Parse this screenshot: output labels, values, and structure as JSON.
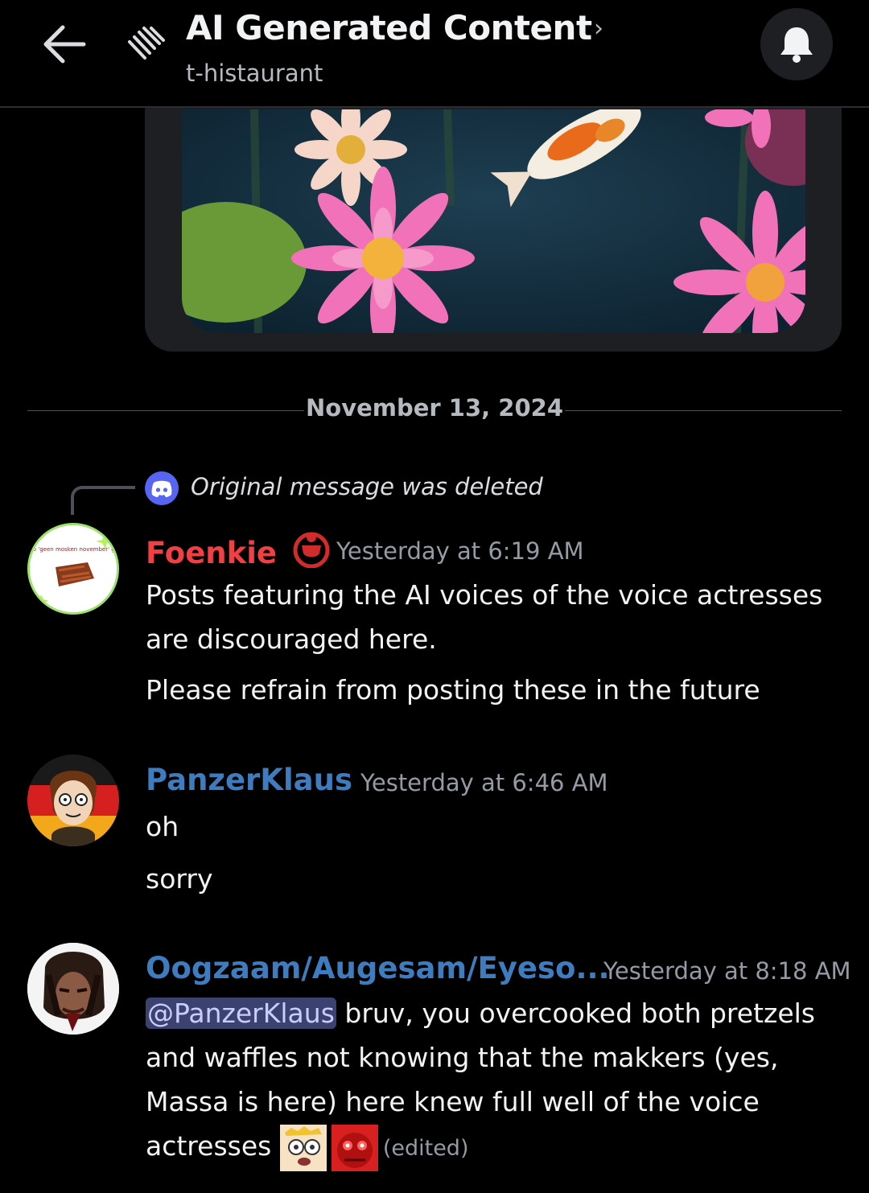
{
  "header": {
    "title": "AI Generated Content",
    "subtitle": "t-histaurant",
    "chevron": "›"
  },
  "date_divider": "November 13, 2024",
  "reply_context": "Original message was deleted",
  "messages": [
    {
      "username": "Foenkie",
      "username_color": "#f23f43",
      "timestamp": "Yesterday at 6:19 AM",
      "lines": [
        "Posts featuring the AI voices of the voice actresses are discouraged here.",
        "Please refrain from posting these in the future"
      ],
      "avatar_caption": "shab 'geen mosken november' gefa"
    },
    {
      "username": "PanzerKlaus",
      "username_color": "#3e7bbf",
      "timestamp": "Yesterday at 6:46 AM",
      "lines": [
        "oh",
        "sorry"
      ]
    },
    {
      "username": "Oogzaam/Augesam/Eyeso...",
      "username_color": "#3e7bbf",
      "timestamp": "Yesterday at 8:18 AM",
      "mention": "@PanzerKlaus",
      "text": " bruv, you overcooked both pretzels and waffles not knowing that the makkers (yes, Massa is here) here knew full well of the voice actresses ",
      "edited": "(edited)"
    }
  ],
  "icons": {
    "back": "arrow-left-icon",
    "thread": "thread-icon",
    "bell": "bell-icon",
    "discord": "discord-icon"
  },
  "colors": {
    "background": "#000000",
    "mention_bg": "#3c4270",
    "blurple": "#5865f2"
  }
}
